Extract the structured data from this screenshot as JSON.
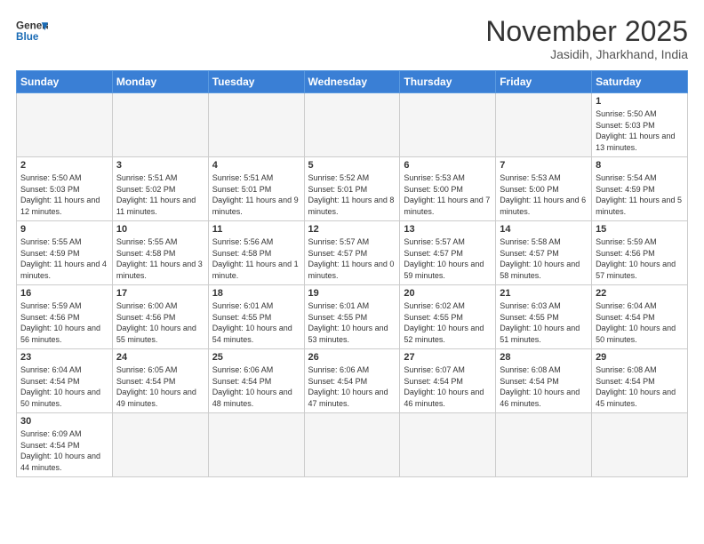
{
  "header": {
    "logo_general": "General",
    "logo_blue": "Blue",
    "month_title": "November 2025",
    "subtitle": "Jasidih, Jharkhand, India"
  },
  "weekdays": [
    "Sunday",
    "Monday",
    "Tuesday",
    "Wednesday",
    "Thursday",
    "Friday",
    "Saturday"
  ],
  "weeks": [
    [
      {
        "day": "",
        "info": ""
      },
      {
        "day": "",
        "info": ""
      },
      {
        "day": "",
        "info": ""
      },
      {
        "day": "",
        "info": ""
      },
      {
        "day": "",
        "info": ""
      },
      {
        "day": "",
        "info": ""
      },
      {
        "day": "1",
        "info": "Sunrise: 5:50 AM\nSunset: 5:03 PM\nDaylight: 11 hours\nand 13 minutes."
      }
    ],
    [
      {
        "day": "2",
        "info": "Sunrise: 5:50 AM\nSunset: 5:03 PM\nDaylight: 11 hours\nand 12 minutes."
      },
      {
        "day": "3",
        "info": "Sunrise: 5:51 AM\nSunset: 5:02 PM\nDaylight: 11 hours\nand 11 minutes."
      },
      {
        "day": "4",
        "info": "Sunrise: 5:51 AM\nSunset: 5:01 PM\nDaylight: 11 hours\nand 9 minutes."
      },
      {
        "day": "5",
        "info": "Sunrise: 5:52 AM\nSunset: 5:01 PM\nDaylight: 11 hours\nand 8 minutes."
      },
      {
        "day": "6",
        "info": "Sunrise: 5:53 AM\nSunset: 5:00 PM\nDaylight: 11 hours\nand 7 minutes."
      },
      {
        "day": "7",
        "info": "Sunrise: 5:53 AM\nSunset: 5:00 PM\nDaylight: 11 hours\nand 6 minutes."
      },
      {
        "day": "8",
        "info": "Sunrise: 5:54 AM\nSunset: 4:59 PM\nDaylight: 11 hours\nand 5 minutes."
      }
    ],
    [
      {
        "day": "9",
        "info": "Sunrise: 5:55 AM\nSunset: 4:59 PM\nDaylight: 11 hours\nand 4 minutes."
      },
      {
        "day": "10",
        "info": "Sunrise: 5:55 AM\nSunset: 4:58 PM\nDaylight: 11 hours\nand 3 minutes."
      },
      {
        "day": "11",
        "info": "Sunrise: 5:56 AM\nSunset: 4:58 PM\nDaylight: 11 hours\nand 1 minute."
      },
      {
        "day": "12",
        "info": "Sunrise: 5:57 AM\nSunset: 4:57 PM\nDaylight: 11 hours\nand 0 minutes."
      },
      {
        "day": "13",
        "info": "Sunrise: 5:57 AM\nSunset: 4:57 PM\nDaylight: 10 hours\nand 59 minutes."
      },
      {
        "day": "14",
        "info": "Sunrise: 5:58 AM\nSunset: 4:57 PM\nDaylight: 10 hours\nand 58 minutes."
      },
      {
        "day": "15",
        "info": "Sunrise: 5:59 AM\nSunset: 4:56 PM\nDaylight: 10 hours\nand 57 minutes."
      }
    ],
    [
      {
        "day": "16",
        "info": "Sunrise: 5:59 AM\nSunset: 4:56 PM\nDaylight: 10 hours\nand 56 minutes."
      },
      {
        "day": "17",
        "info": "Sunrise: 6:00 AM\nSunset: 4:56 PM\nDaylight: 10 hours\nand 55 minutes."
      },
      {
        "day": "18",
        "info": "Sunrise: 6:01 AM\nSunset: 4:55 PM\nDaylight: 10 hours\nand 54 minutes."
      },
      {
        "day": "19",
        "info": "Sunrise: 6:01 AM\nSunset: 4:55 PM\nDaylight: 10 hours\nand 53 minutes."
      },
      {
        "day": "20",
        "info": "Sunrise: 6:02 AM\nSunset: 4:55 PM\nDaylight: 10 hours\nand 52 minutes."
      },
      {
        "day": "21",
        "info": "Sunrise: 6:03 AM\nSunset: 4:55 PM\nDaylight: 10 hours\nand 51 minutes."
      },
      {
        "day": "22",
        "info": "Sunrise: 6:04 AM\nSunset: 4:54 PM\nDaylight: 10 hours\nand 50 minutes."
      }
    ],
    [
      {
        "day": "23",
        "info": "Sunrise: 6:04 AM\nSunset: 4:54 PM\nDaylight: 10 hours\nand 50 minutes."
      },
      {
        "day": "24",
        "info": "Sunrise: 6:05 AM\nSunset: 4:54 PM\nDaylight: 10 hours\nand 49 minutes."
      },
      {
        "day": "25",
        "info": "Sunrise: 6:06 AM\nSunset: 4:54 PM\nDaylight: 10 hours\nand 48 minutes."
      },
      {
        "day": "26",
        "info": "Sunrise: 6:06 AM\nSunset: 4:54 PM\nDaylight: 10 hours\nand 47 minutes."
      },
      {
        "day": "27",
        "info": "Sunrise: 6:07 AM\nSunset: 4:54 PM\nDaylight: 10 hours\nand 46 minutes."
      },
      {
        "day": "28",
        "info": "Sunrise: 6:08 AM\nSunset: 4:54 PM\nDaylight: 10 hours\nand 46 minutes."
      },
      {
        "day": "29",
        "info": "Sunrise: 6:08 AM\nSunset: 4:54 PM\nDaylight: 10 hours\nand 45 minutes."
      }
    ],
    [
      {
        "day": "30",
        "info": "Sunrise: 6:09 AM\nSunset: 4:54 PM\nDaylight: 10 hours\nand 44 minutes."
      },
      {
        "day": "",
        "info": ""
      },
      {
        "day": "",
        "info": ""
      },
      {
        "day": "",
        "info": ""
      },
      {
        "day": "",
        "info": ""
      },
      {
        "day": "",
        "info": ""
      },
      {
        "day": "",
        "info": ""
      }
    ]
  ]
}
